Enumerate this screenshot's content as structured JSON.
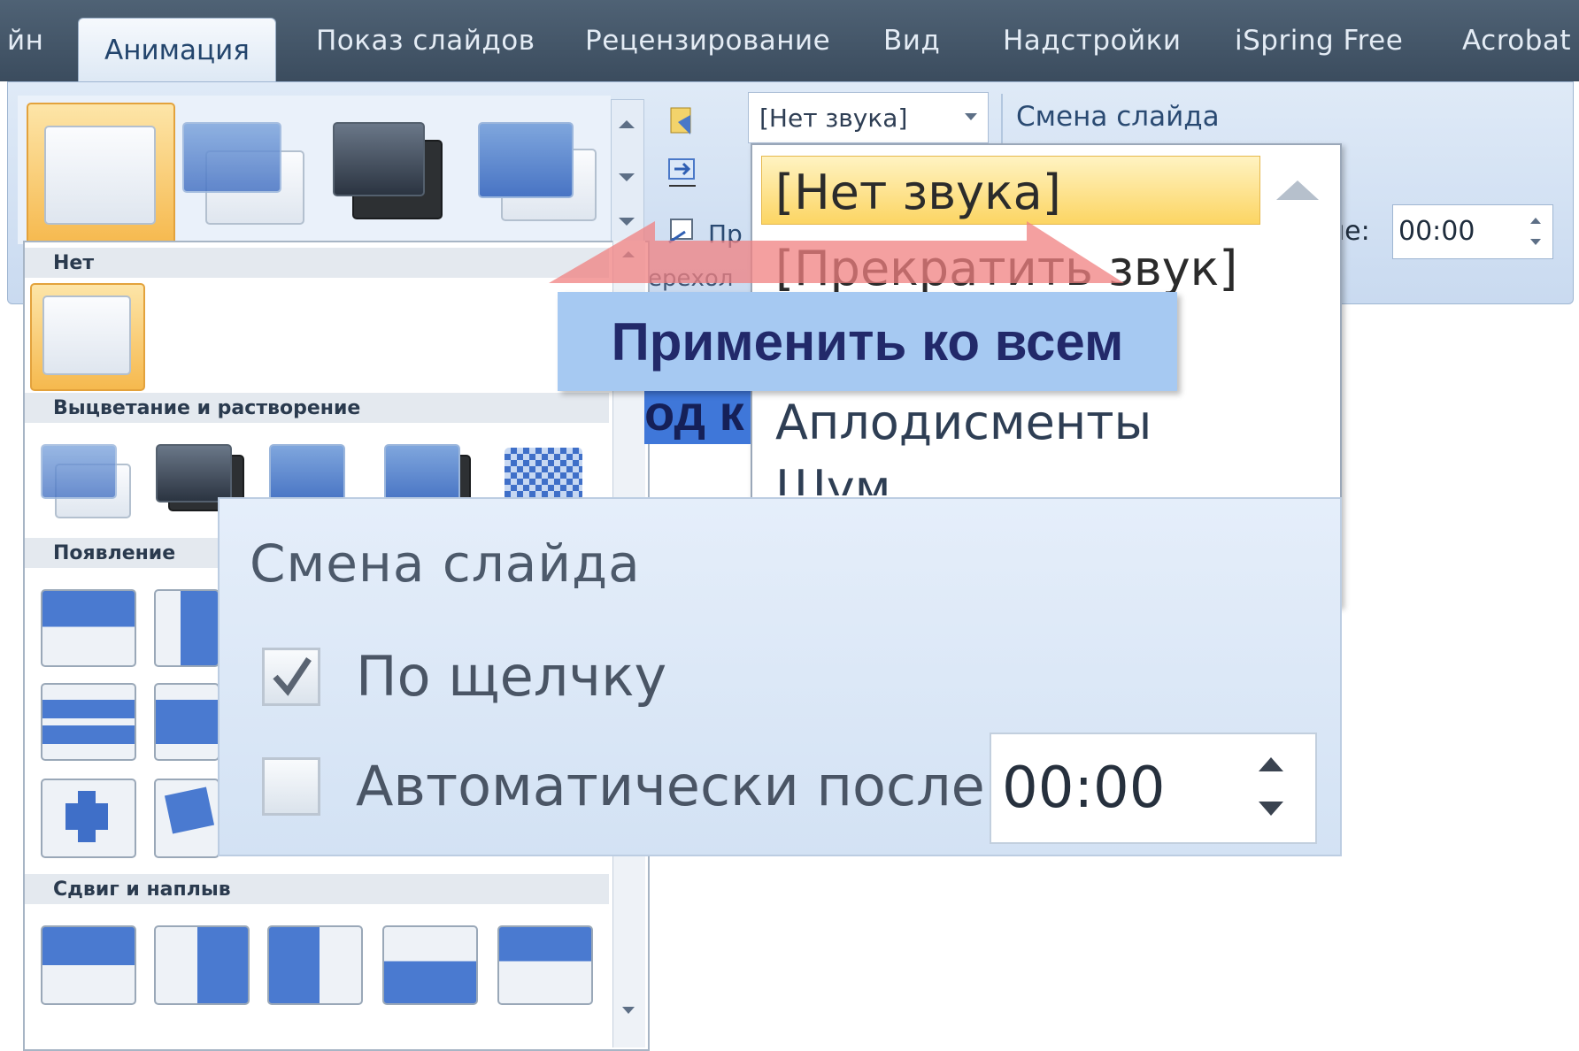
{
  "tabs": [
    {
      "label": "йн",
      "active": false
    },
    {
      "label": "Анимация",
      "active": true
    },
    {
      "label": "Показ слайдов",
      "active": false
    },
    {
      "label": "Рецензирование",
      "active": false
    },
    {
      "label": "Вид",
      "active": false
    },
    {
      "label": "Надстройки",
      "active": false
    },
    {
      "label": "iSpring Free",
      "active": false
    },
    {
      "label": "Acrobat",
      "active": false
    }
  ],
  "ribbon": {
    "sound_combo_value": "[Нет звука]",
    "group_title": "Смена слайда",
    "apply_fragment": "Пр",
    "transition_fragment": "ерехол",
    "auto_after_fragment": "ле:",
    "time_value": "00:00"
  },
  "sound_list": {
    "items": [
      "[Нет звука]",
      "[Прекратить звук]",
      "Аплодисменты",
      "Шум"
    ],
    "selected": "[Нет звука]"
  },
  "gallery": {
    "sections": [
      "Нет",
      "Выцветание и растворение",
      "Появление",
      "Сдвиг и наплыв"
    ]
  },
  "annotation": {
    "text": "Применить ко всем",
    "underlying_fragment": "од к"
  },
  "zoom_panel": {
    "title": "Смена слайда",
    "on_click_label": "По щелчку",
    "on_click_checked": true,
    "auto_after_label": "Автоматически после:",
    "auto_after_checked": false,
    "time_value": "00:00"
  },
  "colors": {
    "tab_bar": "#3b4c5e",
    "ribbon": "#d5e3f4",
    "selection_orange": "#f6b94e",
    "selection_yellow": "#fcd563",
    "annotation_fill": "#a6c9f2",
    "annotation_text": "#22296a",
    "arrow_red": "#f08080"
  }
}
